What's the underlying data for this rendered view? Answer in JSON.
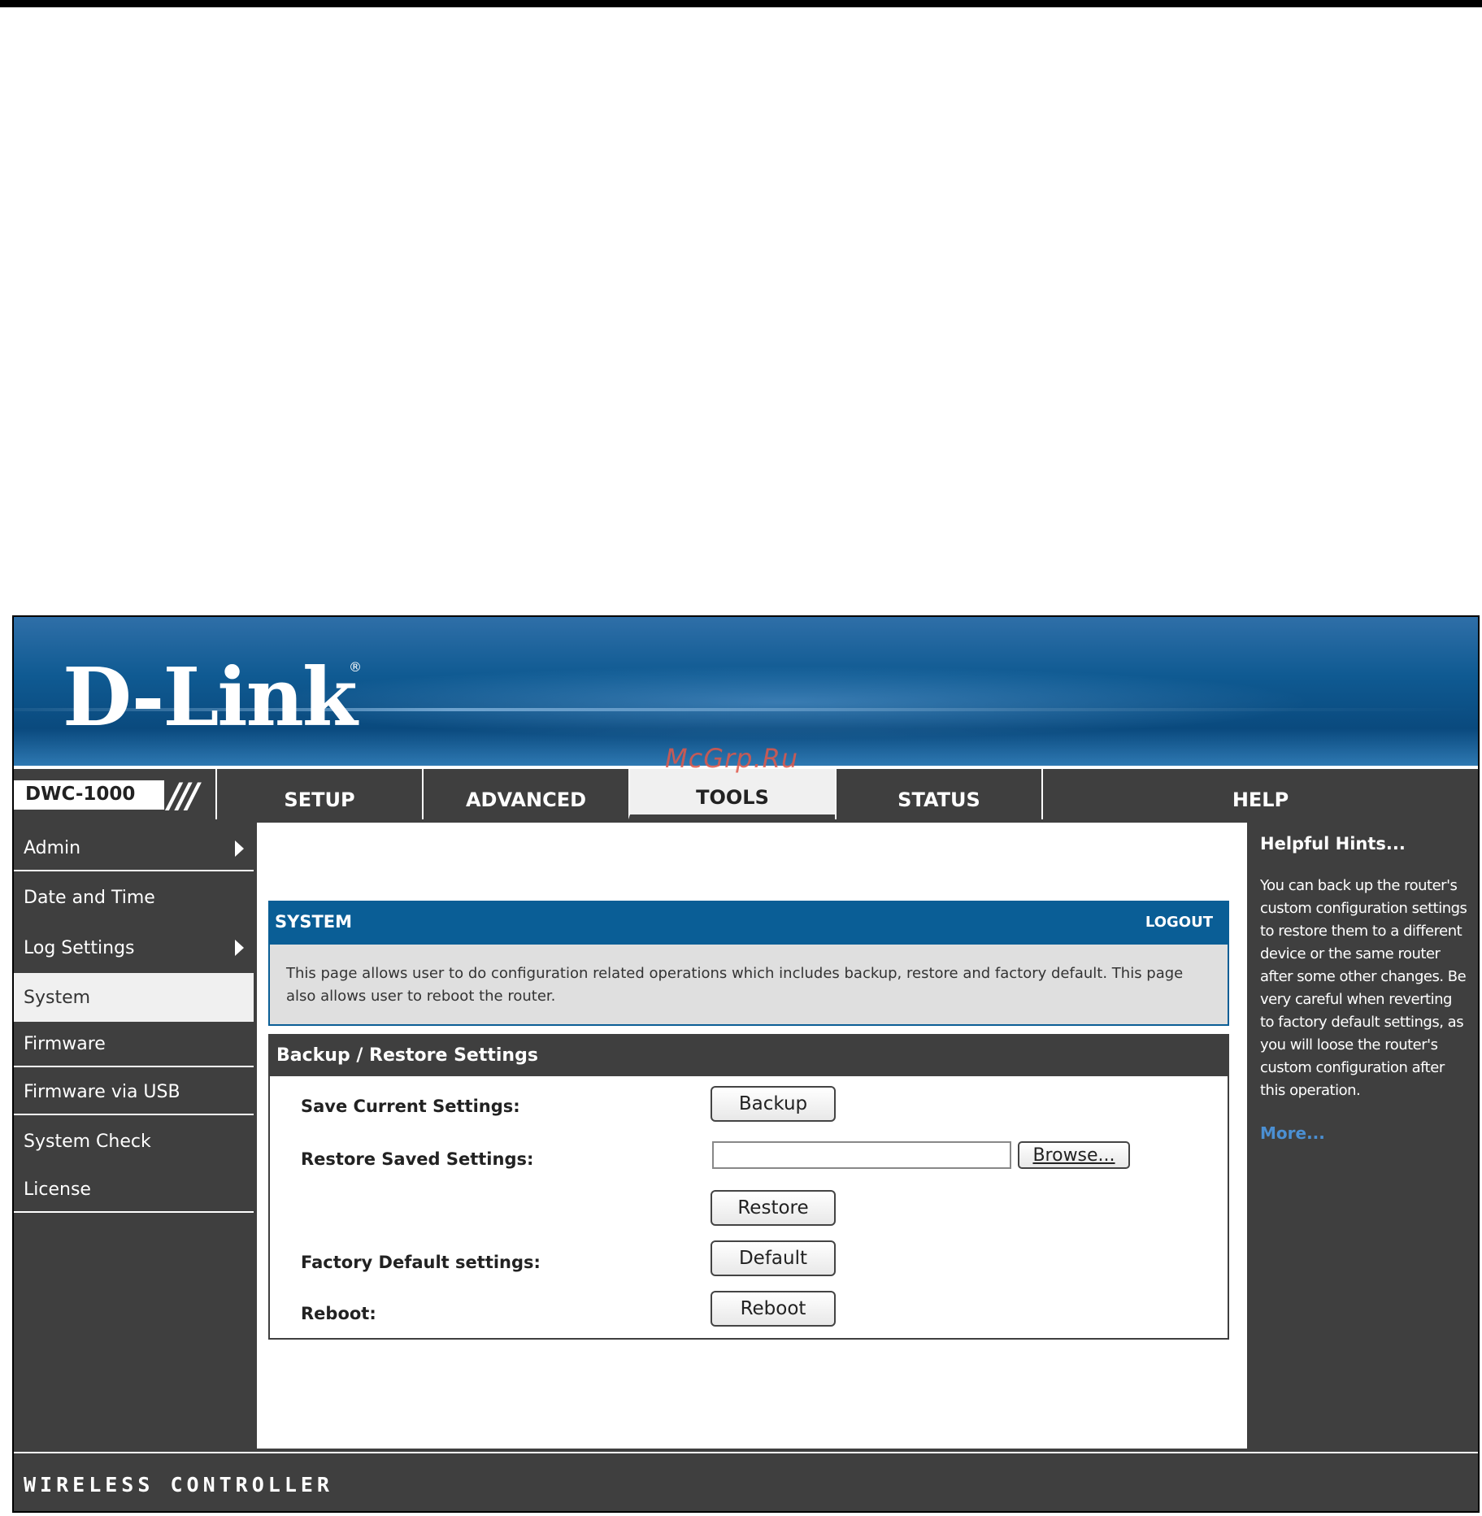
{
  "brand": {
    "logo": "D-Link",
    "registered": "®"
  },
  "model": {
    "name": "DWC-1000",
    "slashes": "///"
  },
  "tabs": [
    {
      "label": "SETUP",
      "active": false
    },
    {
      "label": "ADVANCED",
      "active": false
    },
    {
      "label": "TOOLS",
      "active": true
    },
    {
      "label": "STATUS",
      "active": false
    },
    {
      "label": "HELP",
      "active": false
    }
  ],
  "sidebar": {
    "items": [
      {
        "label": "Admin",
        "has_submenu": true
      },
      {
        "label": "Date and Time",
        "has_submenu": false
      },
      {
        "label": "Log Settings",
        "has_submenu": true
      },
      {
        "label": "System",
        "has_submenu": false,
        "active": true
      },
      {
        "label": "Firmware",
        "has_submenu": false
      },
      {
        "label": "Firmware via USB",
        "has_submenu": false
      },
      {
        "label": "System Check",
        "has_submenu": false
      },
      {
        "label": "License",
        "has_submenu": false
      }
    ]
  },
  "system": {
    "title": "SYSTEM",
    "logout": "LOGOUT",
    "description": "This page allows user to do configuration related operations which includes backup, restore and factory default. This page also allows user to reboot the router."
  },
  "backup_restore": {
    "title": "Backup / Restore Settings",
    "save_label": "Save Current Settings:",
    "backup_button": "Backup",
    "restore_label": "Restore Saved Settings:",
    "file_value": "",
    "browse_button": "Browse...",
    "restore_button": "Restore",
    "factory_label": "Factory Default settings:",
    "default_button": "Default",
    "reboot_label": "Reboot:",
    "reboot_button": "Reboot"
  },
  "hints": {
    "title": "Helpful Hints...",
    "body": "You can back up the router's custom configuration settings to restore them to a different device or the same router after some other changes. Be very careful when reverting to factory default settings, as you will loose the router's custom configuration after this operation.",
    "more": "More..."
  },
  "footer": {
    "text": "WIRELESS CONTROLLER"
  },
  "watermark": "McGrp.Ru",
  "colors": {
    "banner_blue": "#0a5e96",
    "panel_gray": "#3f3f3f",
    "active_tab": "#f0f0f0",
    "link_blue": "#4b8fd2"
  }
}
